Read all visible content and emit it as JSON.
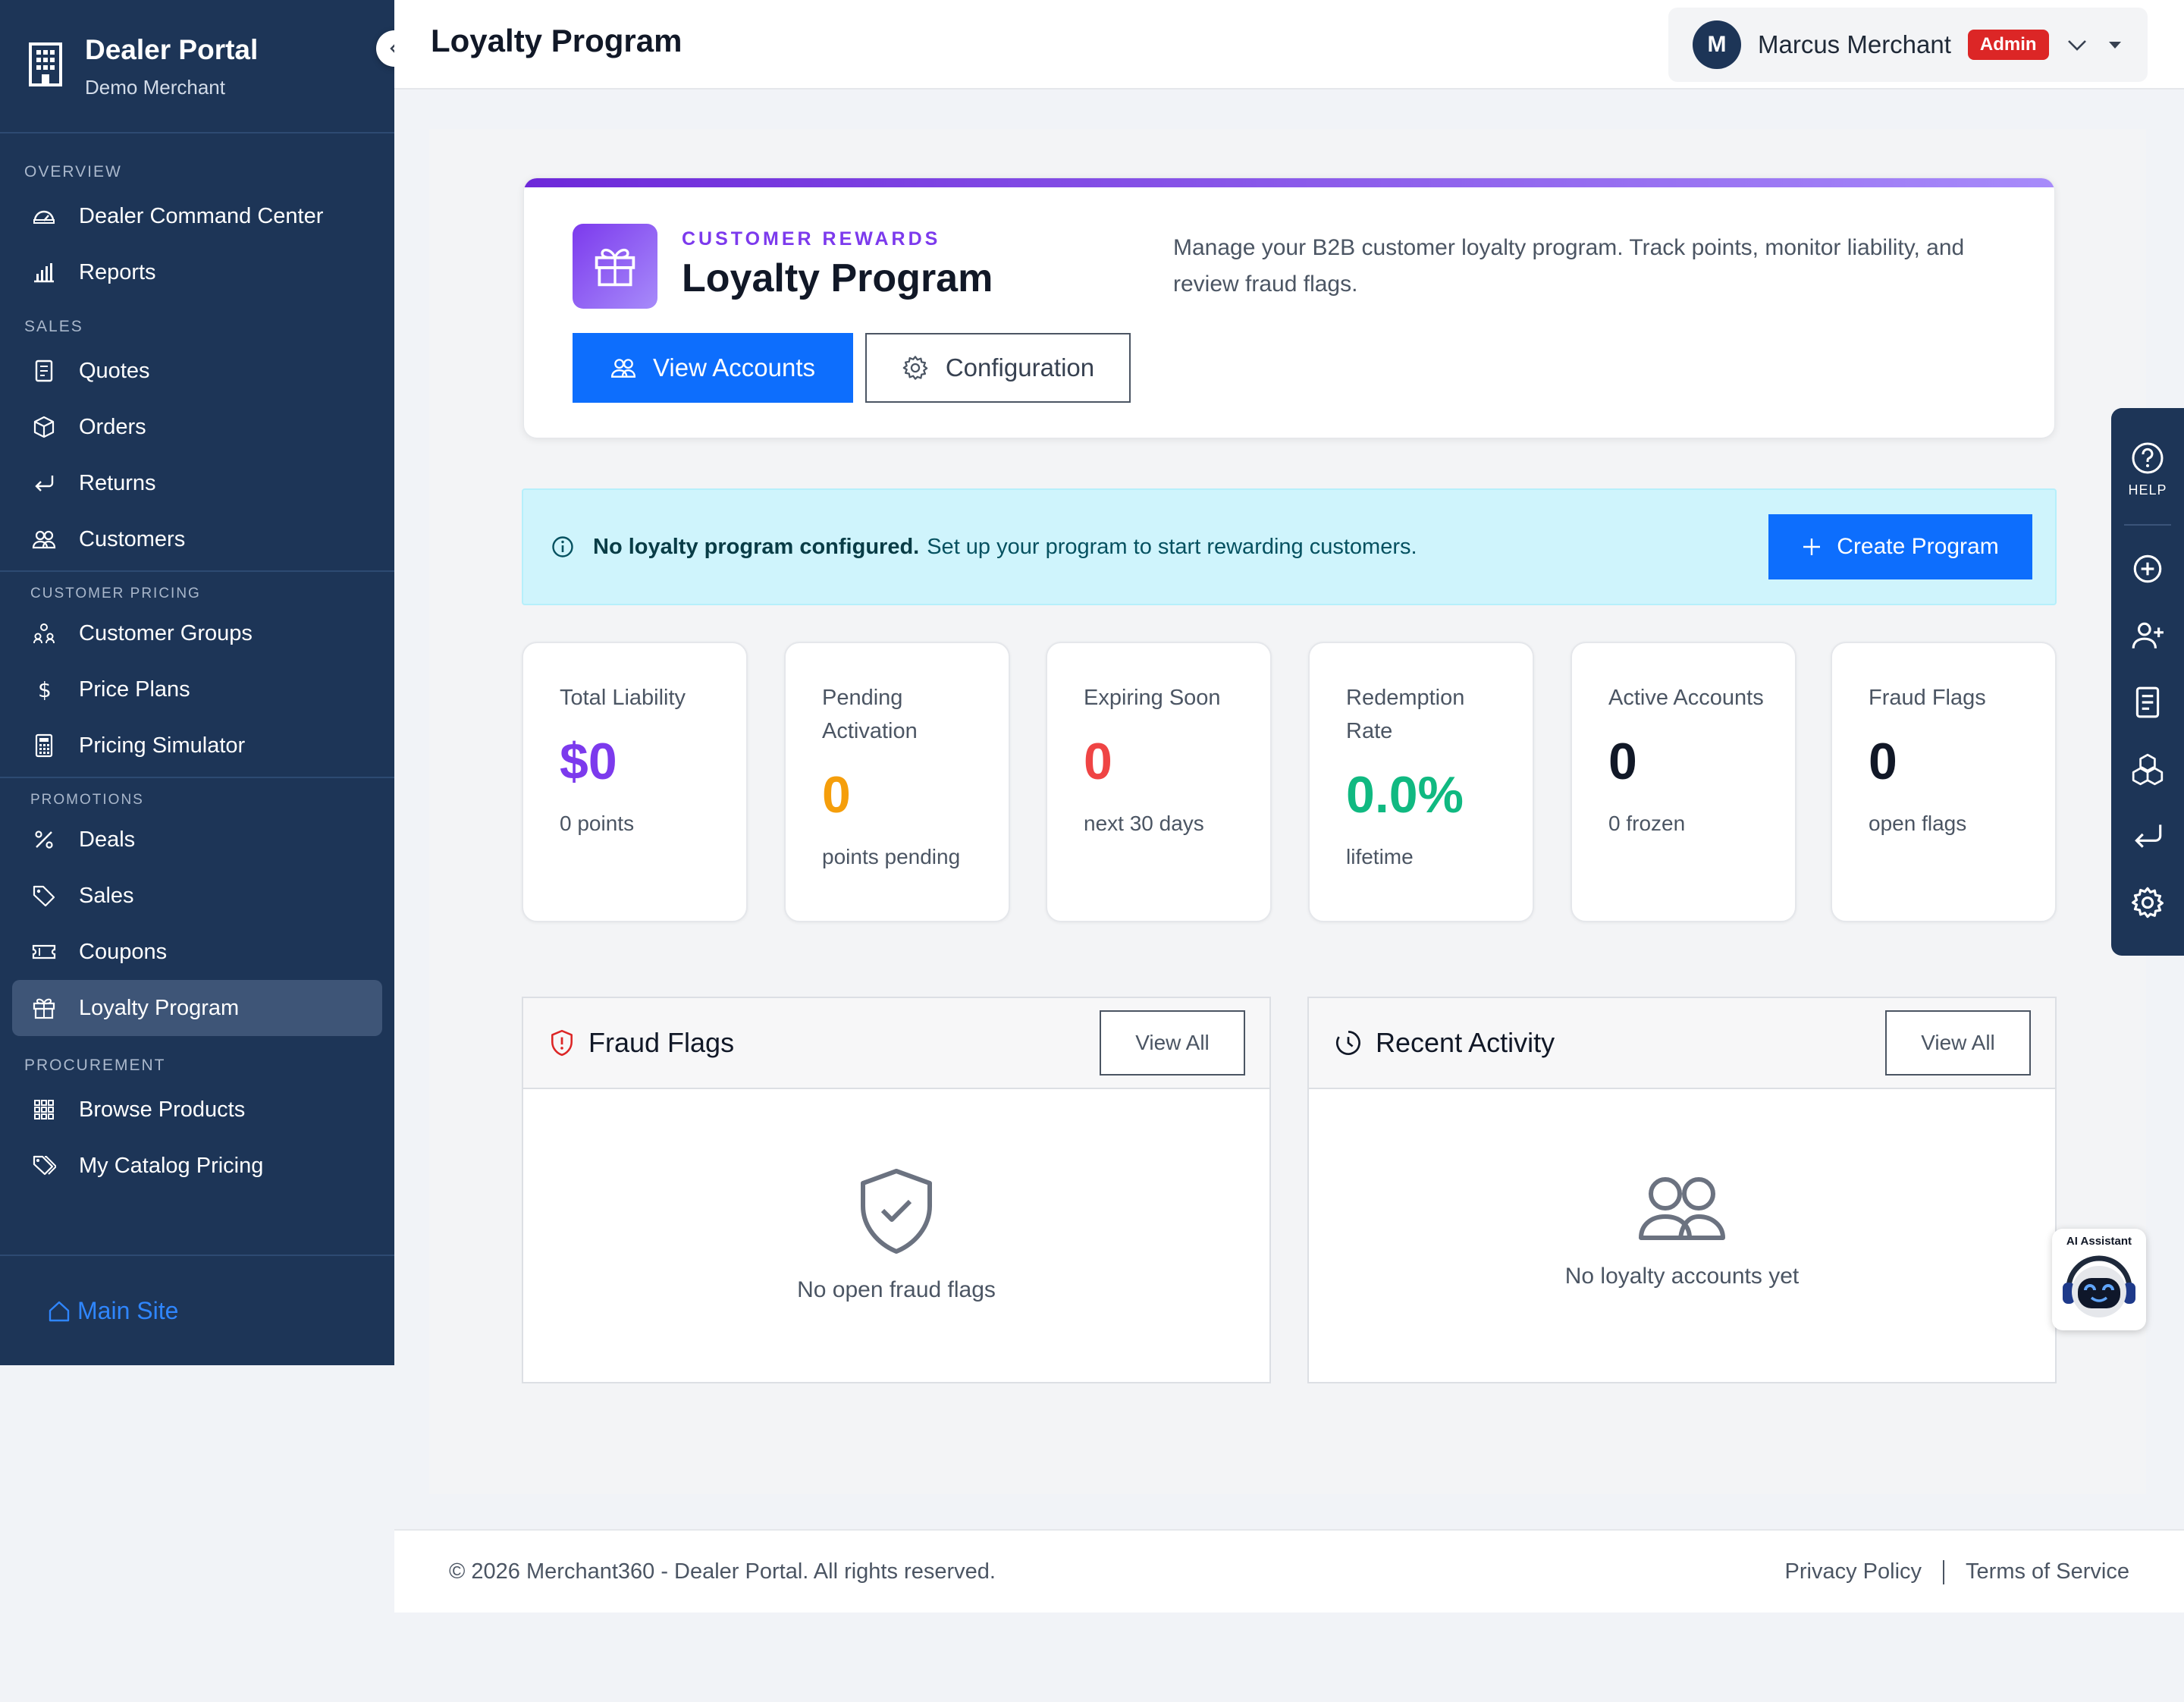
{
  "brand": {
    "title": "Dealer Portal",
    "subtitle": "Demo Merchant"
  },
  "sidebar": {
    "sections": [
      {
        "label": "OVERVIEW",
        "items": [
          {
            "label": "Dealer Command Center",
            "icon": "dashboard-icon"
          },
          {
            "label": "Reports",
            "icon": "bar-chart-icon"
          }
        ]
      },
      {
        "label": "SALES",
        "items": [
          {
            "label": "Quotes",
            "icon": "document-icon"
          },
          {
            "label": "Orders",
            "icon": "box-icon"
          },
          {
            "label": "Returns",
            "icon": "return-arrow-icon"
          },
          {
            "label": "Customers",
            "icon": "people-icon"
          }
        ]
      },
      {
        "label": "CUSTOMER PRICING",
        "items": [
          {
            "label": "Customer Groups",
            "icon": "group-icon"
          },
          {
            "label": "Price Plans",
            "icon": "dollar-icon"
          },
          {
            "label": "Pricing Simulator",
            "icon": "calculator-icon"
          }
        ]
      },
      {
        "label": "PROMOTIONS",
        "items": [
          {
            "label": "Deals",
            "icon": "percent-icon"
          },
          {
            "label": "Sales",
            "icon": "tag-icon"
          },
          {
            "label": "Coupons",
            "icon": "ticket-icon"
          },
          {
            "label": "Loyalty Program",
            "icon": "gift-icon",
            "active": true
          }
        ]
      },
      {
        "label": "PROCUREMENT",
        "items": [
          {
            "label": "Browse Products",
            "icon": "grid-icon"
          },
          {
            "label": "My Catalog Pricing",
            "icon": "tags-icon"
          }
        ]
      }
    ],
    "footer_link": "Main Site"
  },
  "header": {
    "title": "Loyalty Program",
    "user": {
      "initial": "M",
      "name": "Marcus Merchant",
      "role": "Admin"
    }
  },
  "hero": {
    "eyebrow": "CUSTOMER REWARDS",
    "title": "Loyalty Program",
    "description": "Manage your B2B customer loyalty program. Track points, monitor liability, and review fraud flags.",
    "primary_button": "View Accounts",
    "secondary_button": "Configuration"
  },
  "alert": {
    "strong": "No loyalty program configured.",
    "text": "Set up your program to start rewarding customers.",
    "button": "Create Program"
  },
  "stats": [
    {
      "label": "Total Liability",
      "value": "$0",
      "sub": "0 points",
      "color": "#7c3aed"
    },
    {
      "label": "Pending Activation",
      "value": "0",
      "sub": "points pending",
      "color": "#f59e0b"
    },
    {
      "label": "Expiring Soon",
      "value": "0",
      "sub": "next 30 days",
      "color": "#ef4444"
    },
    {
      "label": "Redemption Rate",
      "value": "0.0%",
      "sub": "lifetime",
      "color": "#10b981"
    },
    {
      "label": "Active Accounts",
      "value": "0",
      "sub": "0 frozen",
      "color": "#111827"
    },
    {
      "label": "Fraud Flags",
      "value": "0",
      "sub": "open flags",
      "color": "#111827"
    }
  ],
  "panels": {
    "fraud": {
      "title": "Fraud Flags",
      "button": "View All",
      "empty": "No open fraud flags"
    },
    "activity": {
      "title": "Recent Activity",
      "button": "View All",
      "empty": "No loyalty accounts yet"
    }
  },
  "rail": {
    "help_label": "HELP"
  },
  "ai_assistant": {
    "label": "AI Assistant"
  },
  "footer": {
    "copyright": "© 2026 Merchant360 - Dealer Portal. All rights reserved.",
    "privacy": "Privacy Policy",
    "terms": "Terms of Service"
  }
}
